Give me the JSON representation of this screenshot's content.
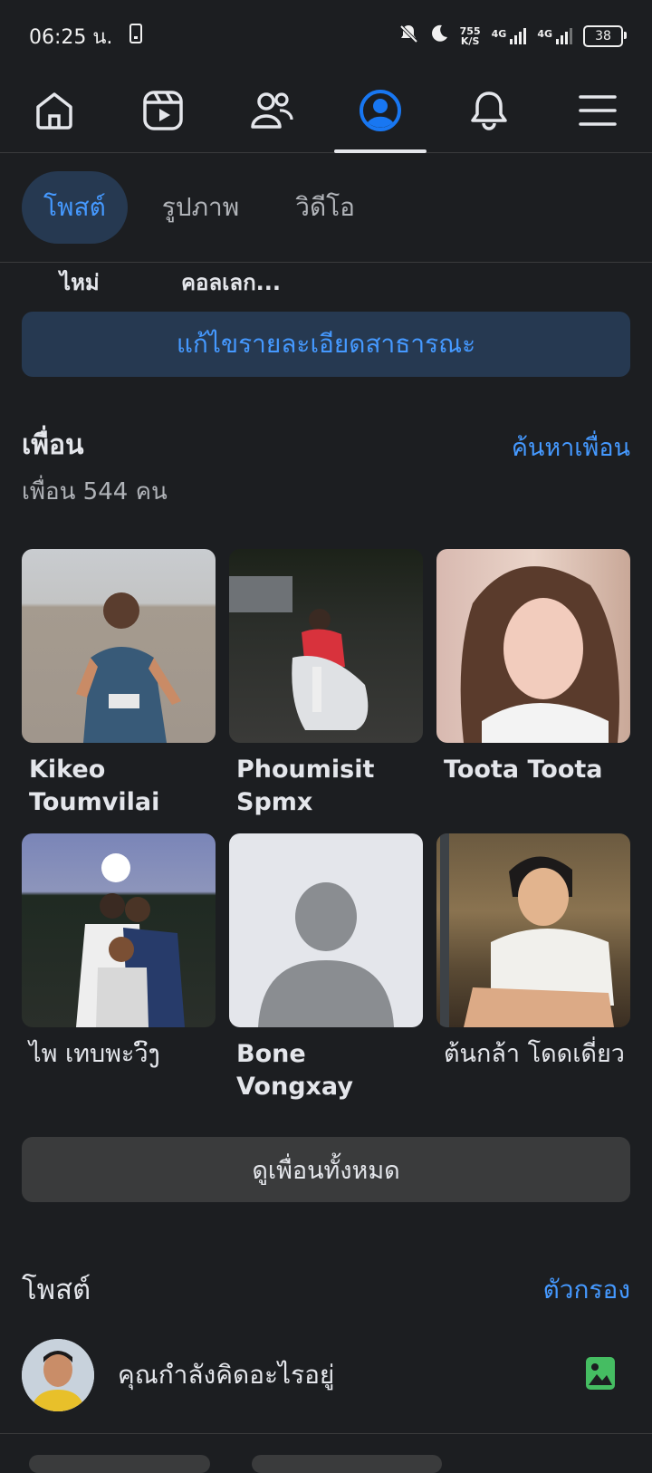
{
  "status_bar": {
    "time": "06:25 น.",
    "net_speed_top": "755",
    "net_speed_bottom": "K/S",
    "signal1": "4G",
    "signal2": "4G",
    "battery": "38"
  },
  "top_nav": {
    "items": [
      "home-icon",
      "reels-icon",
      "friends-icon",
      "profile-icon",
      "bell-icon",
      "menu-icon"
    ],
    "active_index": 3,
    "accent": "#1877f2"
  },
  "sub_tabs": [
    "โพสต์",
    "รูปภาพ",
    "วิดีโอ"
  ],
  "cutoff_labels": [
    "ไหม่",
    "คอลเลก..."
  ],
  "edit_public_details": "แก้ไขรายละเอียดสาธารณะ",
  "friends": {
    "title": "เพื่อน",
    "find_link": "ค้นหาเพื่อน",
    "count_text": "เพื่อน 544 คน",
    "items": [
      {
        "name": "Kikeo Toumvilai"
      },
      {
        "name": "Phoumisit Spmx"
      },
      {
        "name": "Toota Toota"
      },
      {
        "name": "ไพ เทบพะวົງ"
      },
      {
        "name": "Bone Vongxay"
      },
      {
        "name": "ต้นกล้า โดดเดี่ยว"
      }
    ],
    "see_all": "ดูเพื่อนทั้งหมด"
  },
  "posts": {
    "title": "โพสต์",
    "filter": "ตัวกรอง",
    "composer_placeholder": "คุณกำลังคิดอะไรอยู่"
  },
  "colors": {
    "background": "#1c1e21",
    "link": "#4599ff",
    "photo_icon": "#45bd62"
  }
}
